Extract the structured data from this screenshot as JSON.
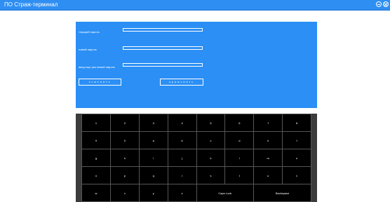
{
  "window": {
    "title": "ПО Страж-терминал"
  },
  "form": {
    "current_password_label": "текущий пароль",
    "new_password_label": "новый пароль",
    "repeat_password_label": "ввод еще раз новый пароль",
    "current_password_value": "",
    "new_password_value": "",
    "repeat_password_value": "",
    "cancel_label": "отменить",
    "apply_label": "применить"
  },
  "keyboard": {
    "row1": [
      "1",
      "2",
      "3",
      "4",
      "5",
      "6",
      "7",
      "8"
    ],
    "row2": [
      "9",
      "0",
      "a",
      "b",
      "c",
      "d",
      "e",
      "f"
    ],
    "row3": [
      "g",
      "h",
      "i",
      "j",
      "k",
      "l",
      "m",
      "n"
    ],
    "row4": [
      "o",
      "p",
      "q",
      "r",
      "s",
      "t",
      "u",
      "v"
    ],
    "row5": [
      "w",
      "x",
      "y",
      "z",
      "Caps Lock",
      "Backspace"
    ]
  }
}
